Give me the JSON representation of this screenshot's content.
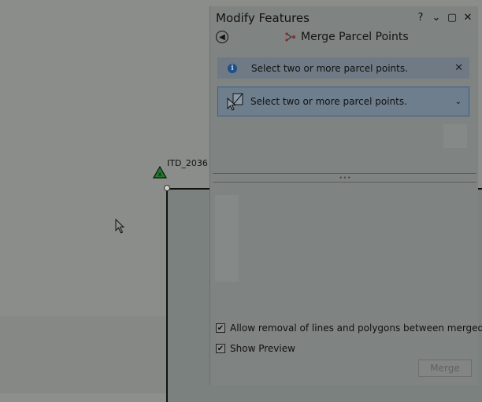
{
  "map": {
    "point_label": "ITD_2036"
  },
  "pane": {
    "title": "Modify Features",
    "help": "?",
    "dropdown": "⌄",
    "maximize": "▢",
    "close": "✕",
    "back_icon": "arrow-left-circle-icon",
    "tool_title": "Merge Parcel Points",
    "info_message": "Select two or more parcel points.",
    "info_close": "✕",
    "selection_text": "Select two or more parcel points.",
    "selection_chevron": "⌄",
    "grip": "•••",
    "options": [
      {
        "label": "Allow removal of lines and polygons between merged poi",
        "checked": true
      },
      {
        "label": "Show Preview",
        "checked": true
      }
    ],
    "merge_label": "Merge"
  },
  "colors": {
    "info_bar": "#6f7a84",
    "selection_border": "#3a5f86"
  }
}
